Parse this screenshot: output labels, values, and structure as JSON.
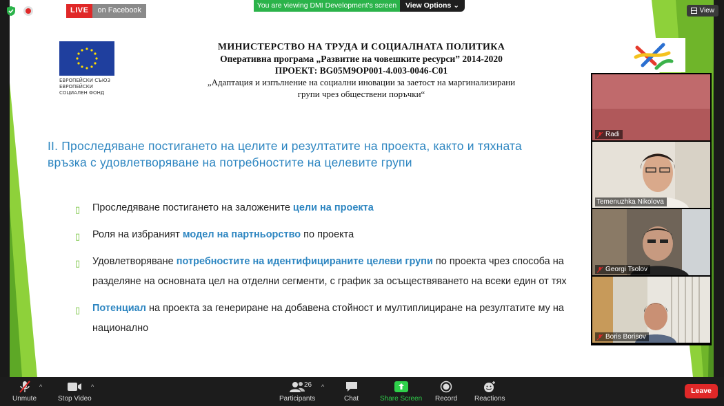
{
  "live": {
    "label": "LIVE",
    "platform": "on Facebook"
  },
  "banner": {
    "viewing_text": "You are viewing DMI Development's screen",
    "view_options": "View Options"
  },
  "view_button": {
    "label": "View"
  },
  "slide": {
    "eu_caption": [
      "ЕВРОПЕЙСКИ СЪЮЗ",
      "ЕВРОПЕЙСКИ",
      "СОЦИАЛЕН ФОНД"
    ],
    "header": {
      "line1": "МИНИСТЕРСТВО НА ТРУДА И СОЦИАЛНАТА ПОЛИТИКА",
      "line2": "Оперативна програма „Развитие на човешките ресурси” 2014-2020",
      "line3": "ПРОЕКТ: BG05M9OP001-4.003-0046-C01",
      "line4": "„Адаптация и изпълнение на социални иновации за заетост на маргинализирани",
      "line5": "групи чрез обществени поръчки“"
    },
    "title": "II. Проследяване постигането на целите и резултатите на проекта, както и тяхната връзка с удовлетворяване на потребностите на целевите групи",
    "bullets": [
      {
        "pre": "Проследяване постигането на заложените ",
        "hl": "цели на проекта",
        "post": ""
      },
      {
        "pre": "Роля на избраният ",
        "hl": "модел на партньорство",
        "post": " по проекта"
      },
      {
        "pre": "Удовлетворяване ",
        "hl": "потребностите на идентифицираните целеви групи",
        "post": " по проекта чрез способа на разделяне на основната цел на отделни сегменти, с график за осъществяването на всеки един от тях"
      },
      {
        "pre": "",
        "hl": "Потенциал",
        "post": " на проекта за генериране на добавена стойност и мултиплициране на резултатите му на национално"
      }
    ]
  },
  "participants": [
    {
      "name": "Radi"
    },
    {
      "name": "Temenuzhka Nikolova"
    },
    {
      "name": "Georgi Tsolov"
    },
    {
      "name": "Boris Borisov"
    }
  ],
  "toolbar": {
    "unmute": "Unmute",
    "stop_video": "Stop Video",
    "participants": "Participants",
    "participant_count": "26",
    "chat": "Chat",
    "share_screen": "Share Screen",
    "record": "Record",
    "reactions": "Reactions",
    "leave": "Leave"
  },
  "colors": {
    "accent_blue": "#2e86c1",
    "bullet_green": "#6abf2e",
    "share_green": "#2fd14b",
    "leave_red": "#e02828",
    "banner_green": "#2bb34a"
  }
}
